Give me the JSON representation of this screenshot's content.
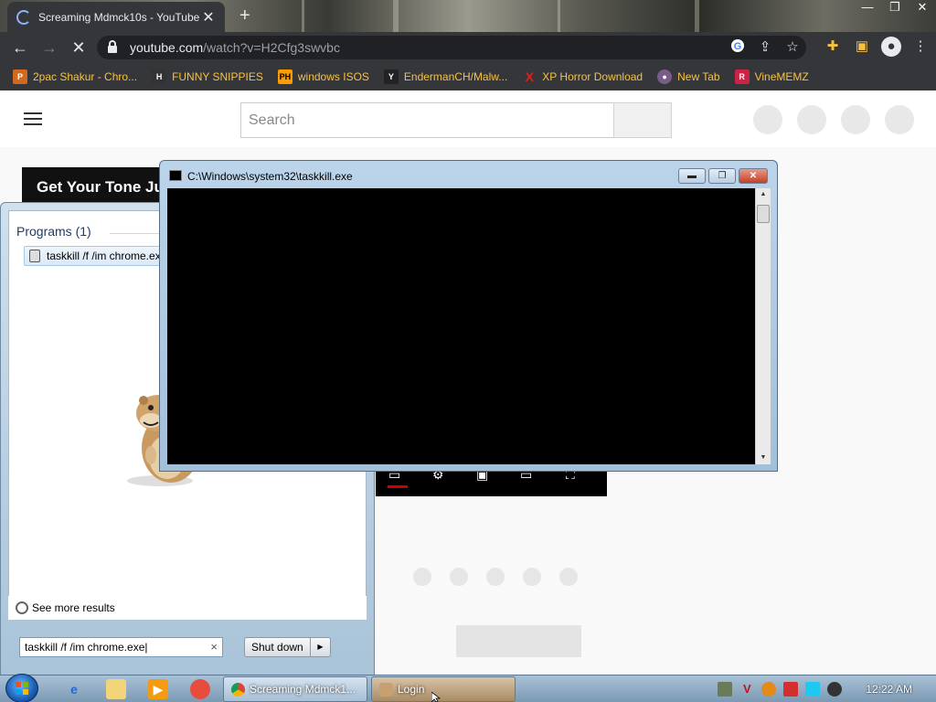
{
  "browser": {
    "tab_title": "Screaming Mdmck10s - YouTube",
    "tab_close": "✕",
    "new_tab": "+",
    "window_controls": [
      "—",
      "❐",
      "✕"
    ],
    "url_domain": "youtube.com",
    "url_path": "/watch?v=H2Cfg3swvbc",
    "nav": {
      "back": "←",
      "forward": "→",
      "reload": "✕"
    },
    "bookmarks": [
      {
        "label": "2pac Shakur - Chro...",
        "icon": "P",
        "color": "#d2691e"
      },
      {
        "label": "FUNNY SNIPPIES",
        "icon": "H",
        "color": "#333333"
      },
      {
        "label": "windows ISOS",
        "icon": "PH",
        "color": "#ff9900"
      },
      {
        "label": "EndermanCH/Malw...",
        "icon": "Y",
        "color": "#222222"
      },
      {
        "label": "XP Horror Download",
        "icon": "X",
        "color": "#e02020"
      },
      {
        "label": "New Tab",
        "icon": "●",
        "color": "#7a5c8a"
      },
      {
        "label": "VineMEMZ",
        "icon": "R",
        "color": "#cc2244"
      }
    ]
  },
  "youtube": {
    "search_placeholder": "Search",
    "promo_text": "Get Your Tone Ju"
  },
  "start_menu": {
    "programs_label": "Programs (1)",
    "result_item": "taskkill /f /im chrome.exe",
    "see_more": "See more results",
    "search_value": "taskkill /f /im chrome.exe",
    "search_clear": "×",
    "shutdown_label": "Shut down",
    "shutdown_arrow": "▶"
  },
  "console": {
    "title": "C:\\Windows\\system32\\taskkill.exe",
    "minimize": "▬",
    "maximize": "❐",
    "close": "✕"
  },
  "taskbar": {
    "chrome_task": "Screaming Mdmck1...",
    "login_task": "Login",
    "clock": "12:22 AM"
  }
}
